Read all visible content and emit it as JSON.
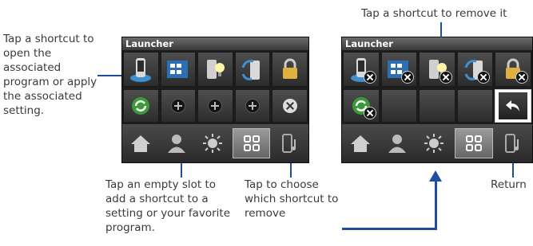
{
  "callouts": {
    "left": "Tap a shortcut to open the associated program or apply the associated setting.",
    "empty_slot": "Tap an empty slot to add a shortcut to a setting or your favorite program.",
    "choose_remove": "Tap to choose which shortcut to remove",
    "remove_it": "Tap a shortcut to remove it",
    "return": "Return"
  },
  "panel_normal": {
    "title": "Launcher",
    "shortcuts": [
      "phone-icon",
      "start-menu-icon",
      "light-icon",
      "sync-icon",
      "lock-icon"
    ],
    "second_row": [
      "refresh-icon",
      "empty-slot",
      "empty-slot",
      "empty-slot",
      "remove-mode"
    ],
    "nav": [
      "home-icon",
      "people-icon",
      "brightness-icon",
      "launcher-icon",
      "media-icon"
    ]
  },
  "panel_remove": {
    "title": "Launcher",
    "shortcuts": [
      "phone-icon",
      "start-menu-icon",
      "light-icon",
      "sync-icon",
      "lock-icon"
    ],
    "second_row": [
      "refresh-icon",
      "empty",
      "empty",
      "empty",
      "return-icon"
    ],
    "nav": [
      "home-icon",
      "people-icon",
      "brightness-icon",
      "launcher-icon",
      "media-icon"
    ]
  },
  "colors": {
    "callout_line": "#1f4e9c",
    "panel_bg": "#1d1d1d"
  }
}
